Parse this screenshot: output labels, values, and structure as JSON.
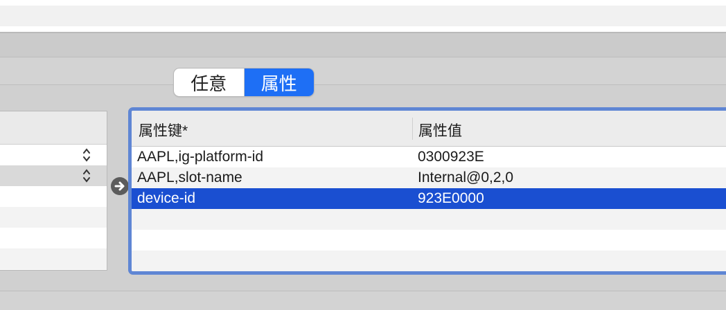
{
  "segmented_control": {
    "options": [
      "任意",
      "属性"
    ],
    "selected": "属性"
  },
  "properties_table": {
    "columns": [
      "属性键*",
      "属性值"
    ],
    "rows": [
      {
        "key": "AAPL,ig-platform-id",
        "value": "0300923E"
      },
      {
        "key": "AAPL,slot-name",
        "value": "Internal@0,2,0"
      },
      {
        "key": "device-id",
        "value": "923E0000"
      }
    ],
    "selected_row": 2
  },
  "colors": {
    "accent": "#1e6ff5",
    "selection": "#1a4fd1",
    "focus_ring": "#5f86d4"
  },
  "icons": {
    "stepper": "up-down-chevron-icon",
    "transfer": "arrow-right-circle-icon"
  }
}
